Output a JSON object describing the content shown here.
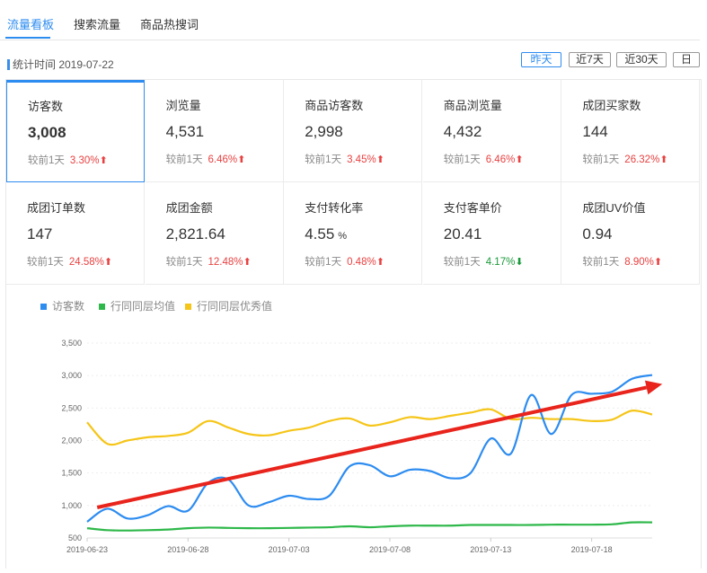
{
  "tabs": [
    {
      "label": "流量看板"
    },
    {
      "label": "搜索流量"
    },
    {
      "label": "商品热搜词"
    }
  ],
  "stat_time": "统计时间 2019-07-22",
  "ranges": [
    "昨天",
    "近7天",
    "近30天",
    "日"
  ],
  "compare_label": "较前1天",
  "metrics": [
    {
      "title": "访客数",
      "value": "3,008",
      "pct": "3.30%",
      "dir": "up"
    },
    {
      "title": "浏览量",
      "value": "4,531",
      "pct": "6.46%",
      "dir": "up"
    },
    {
      "title": "商品访客数",
      "value": "2,998",
      "pct": "3.45%",
      "dir": "up"
    },
    {
      "title": "商品浏览量",
      "value": "4,432",
      "pct": "6.46%",
      "dir": "up"
    },
    {
      "title": "成团买家数",
      "value": "144",
      "pct": "26.32%",
      "dir": "up"
    },
    {
      "title": "成团订单数",
      "value": "147",
      "pct": "24.58%",
      "dir": "up"
    },
    {
      "title": "成团金额",
      "value": "2,821.64",
      "pct": "12.48%",
      "dir": "up"
    },
    {
      "title": "支付转化率",
      "value": "4.55",
      "unit": "%",
      "pct": "0.48%",
      "dir": "up"
    },
    {
      "title": "支付客单价",
      "value": "20.41",
      "pct": "4.17%",
      "dir": "down"
    },
    {
      "title": "成团UV价值",
      "value": "0.94",
      "pct": "8.90%",
      "dir": "up"
    }
  ],
  "chart_data": {
    "type": "line",
    "series": [
      {
        "name": "访客数",
        "color": "#2d8cf0",
        "values": [
          750,
          950,
          800,
          850,
          990,
          920,
          1350,
          1400,
          1000,
          1050,
          1150,
          1100,
          1150,
          1600,
          1620,
          1450,
          1550,
          1530,
          1420,
          1500,
          2030,
          1800,
          2700,
          2100,
          2700,
          2720,
          2750,
          2950,
          3008
        ]
      },
      {
        "name": "行同同层均值",
        "color": "#2eb84a",
        "values": [
          650,
          620,
          615,
          620,
          630,
          650,
          660,
          655,
          650,
          650,
          655,
          660,
          665,
          680,
          665,
          680,
          690,
          690,
          690,
          700,
          700,
          700,
          700,
          705,
          705,
          705,
          710,
          740,
          740
        ]
      },
      {
        "name": "行同同层优秀值",
        "color": "#f5c518",
        "values": [
          2280,
          1950,
          2000,
          2050,
          2070,
          2120,
          2300,
          2200,
          2100,
          2080,
          2150,
          2200,
          2300,
          2340,
          2230,
          2280,
          2360,
          2330,
          2380,
          2430,
          2480,
          2330,
          2350,
          2330,
          2330,
          2300,
          2320,
          2460,
          2400
        ]
      }
    ],
    "x_ticks": [
      "2019-06-23",
      "2019-06-28",
      "2019-07-03",
      "2019-07-08",
      "2019-07-13",
      "2019-07-18"
    ],
    "y_ticks": [
      "500",
      "1,000",
      "1,500",
      "2,000",
      "2,500",
      "3,000",
      "3,500"
    ],
    "ylim": [
      500,
      3500
    ],
    "legend_position": "top-left",
    "annotation": {
      "type": "trend-arrow",
      "color": "#e8241c",
      "from": {
        "index": 0.5,
        "value": 970
      },
      "to": {
        "index": 28.5,
        "value": 2870
      }
    }
  }
}
